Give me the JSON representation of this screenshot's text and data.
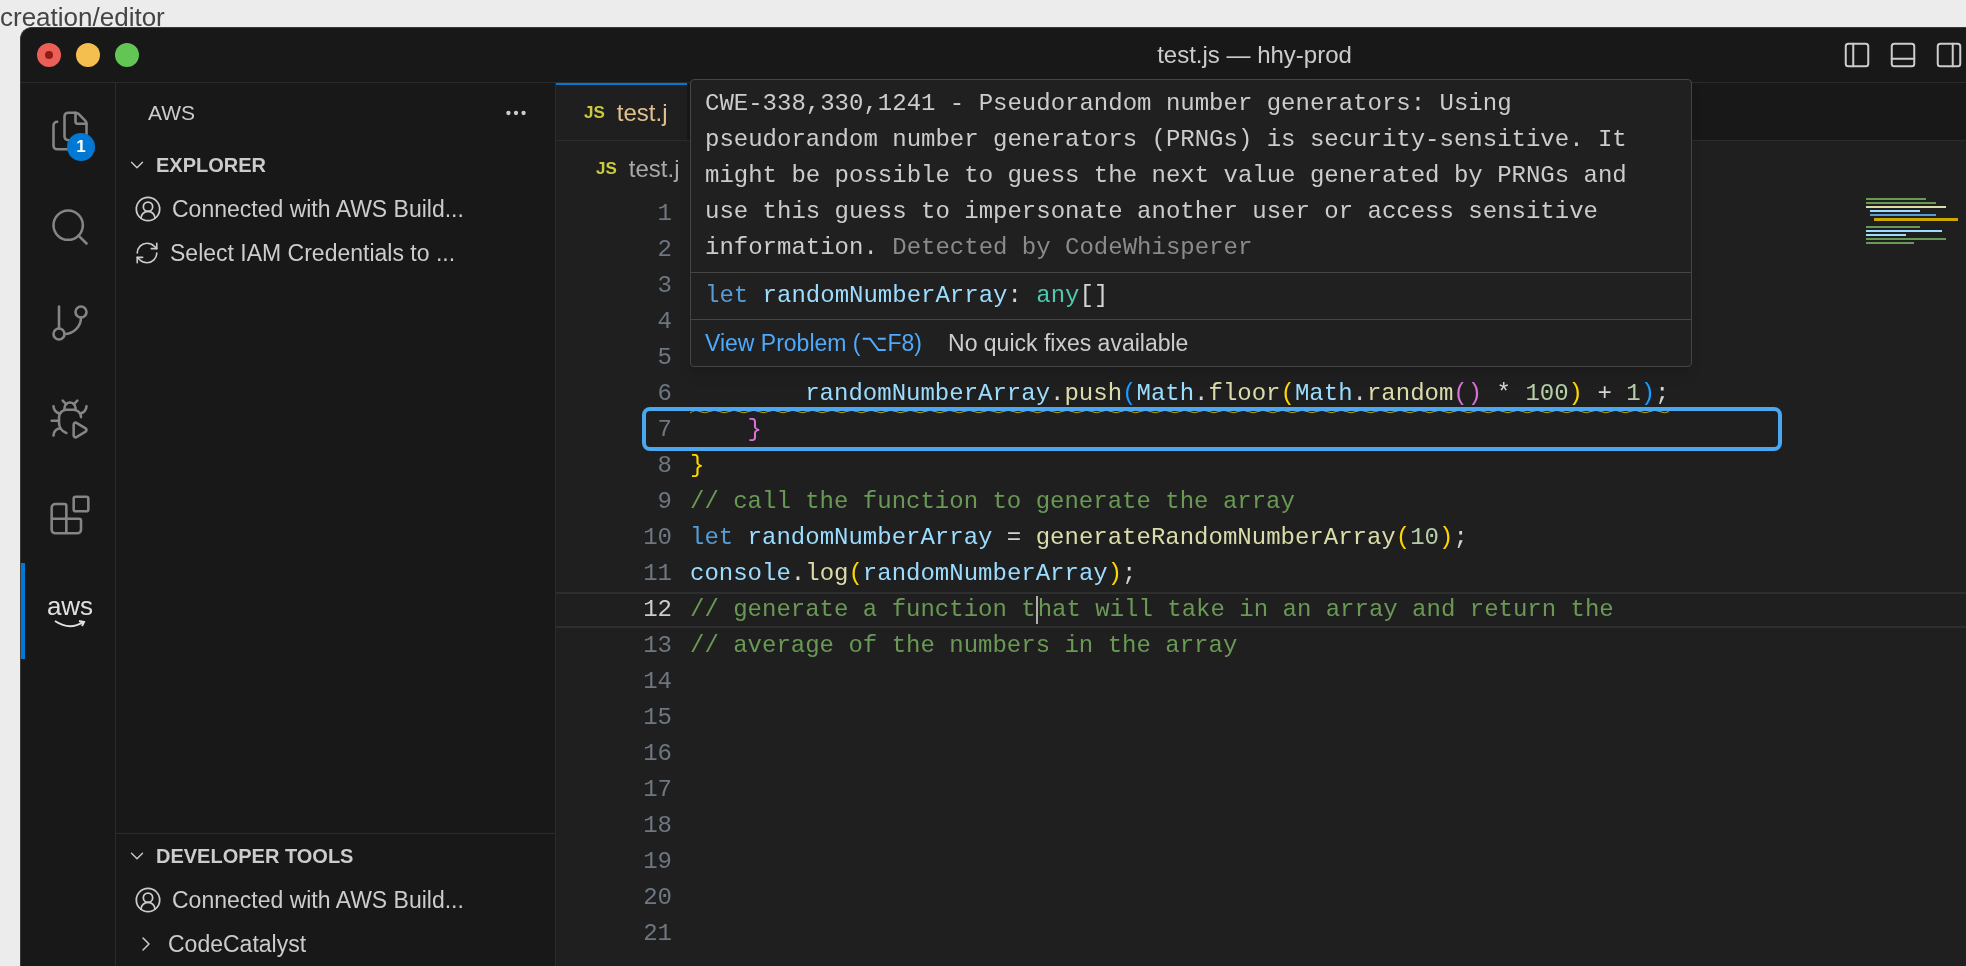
{
  "browser": {
    "url": "creation/editor"
  },
  "window": {
    "title": "test.js — hhy-prod"
  },
  "activity_bar": [
    {
      "kind": "files",
      "badge": "1",
      "selected": false
    },
    {
      "kind": "search",
      "selected": false
    },
    {
      "kind": "source-control",
      "selected": false
    },
    {
      "kind": "run-debug",
      "selected": false
    },
    {
      "kind": "extensions",
      "selected": false
    },
    {
      "kind": "aws",
      "label": "aws",
      "selected": true
    }
  ],
  "sidebar": {
    "title": "AWS",
    "sections": [
      {
        "title": "EXPLORER",
        "expanded": true,
        "items": [
          {
            "kind": "account",
            "label": "Connected with AWS Build..."
          },
          {
            "kind": "sync",
            "label": "Select IAM Credentials to ..."
          }
        ]
      },
      {
        "title": "DEVELOPER TOOLS",
        "expanded": true,
        "items": [
          {
            "kind": "account",
            "label": "Connected with AWS Build..."
          },
          {
            "kind": "node",
            "expanded": false,
            "label": "CodeCatalyst"
          }
        ]
      }
    ]
  },
  "tabs": [
    {
      "file_icon": "JS",
      "label": "test.j",
      "selected": true
    }
  ],
  "breadcrumb": {
    "file_icon": "JS",
    "label": "test.j"
  },
  "editor": {
    "lines": [
      {
        "number": "1"
      },
      {
        "number": "2"
      },
      {
        "number": "3"
      },
      {
        "number": "4"
      },
      {
        "number": "5"
      },
      {
        "number": "6",
        "problem": true,
        "tokens": [
          {
            "kind": "var",
            "text": "        randomNumberArray"
          },
          {
            "kind": "plain",
            "text": "."
          },
          {
            "kind": "func",
            "text": "push"
          },
          {
            "kind": "bracket3",
            "text": "("
          },
          {
            "kind": "var",
            "text": "Math"
          },
          {
            "kind": "plain",
            "text": "."
          },
          {
            "kind": "func",
            "text": "floor"
          },
          {
            "kind": "bracket1",
            "text": "("
          },
          {
            "kind": "var",
            "text": "Math"
          },
          {
            "kind": "plain",
            "text": "."
          },
          {
            "kind": "func",
            "text": "random"
          },
          {
            "kind": "bracket2",
            "text": "()"
          },
          {
            "kind": "plain",
            "text": " * "
          },
          {
            "kind": "number",
            "text": "100"
          },
          {
            "kind": "bracket1",
            "text": ")"
          },
          {
            "kind": "plain",
            "text": " + "
          },
          {
            "kind": "number",
            "text": "1"
          },
          {
            "kind": "bracket3",
            "text": ")"
          },
          {
            "kind": "plain",
            "text": ";"
          }
        ]
      },
      {
        "number": "7",
        "tokens": [
          {
            "kind": "bracket2",
            "text": "    }"
          }
        ]
      },
      {
        "number": "8",
        "tokens": [
          {
            "kind": "bracket1",
            "text": "}"
          }
        ]
      },
      {
        "number": "9",
        "tokens": [
          {
            "kind": "comment",
            "text": "// call the function to generate the array"
          }
        ]
      },
      {
        "number": "10",
        "tokens": [
          {
            "kind": "keyword",
            "text": "let"
          },
          {
            "kind": "var",
            "text": " randomNumberArray"
          },
          {
            "kind": "plain",
            "text": " = "
          },
          {
            "kind": "func",
            "text": "generateRandomNumberArray"
          },
          {
            "kind": "bracket1",
            "text": "("
          },
          {
            "kind": "number",
            "text": "10"
          },
          {
            "kind": "bracket1",
            "text": ")"
          },
          {
            "kind": "plain",
            "text": ";"
          }
        ]
      },
      {
        "number": "11",
        "tokens": [
          {
            "kind": "var",
            "text": "console"
          },
          {
            "kind": "plain",
            "text": "."
          },
          {
            "kind": "func",
            "text": "log"
          },
          {
            "kind": "bracket1",
            "text": "("
          },
          {
            "kind": "var",
            "text": "randomNumberArray"
          },
          {
            "kind": "bracket1",
            "text": ")"
          },
          {
            "kind": "plain",
            "text": ";"
          }
        ]
      },
      {
        "number": "12",
        "current": true,
        "tokens": [
          {
            "kind": "comment",
            "text": "// generate a function t"
          },
          {
            "kind": "cursor"
          },
          {
            "kind": "comment",
            "text": "hat will take in an array and return the"
          }
        ]
      },
      {
        "number": "13",
        "tokens": [
          {
            "kind": "comment",
            "text": "// average of the numbers in the array"
          }
        ]
      },
      {
        "number": "14"
      },
      {
        "number": "15"
      },
      {
        "number": "16"
      },
      {
        "number": "17"
      },
      {
        "number": "18"
      },
      {
        "number": "19"
      },
      {
        "number": "20"
      },
      {
        "number": "21"
      }
    ]
  },
  "hover": {
    "message": "CWE-338,330,1241 - Pseudorandom number generators: Using pseudorandom number generators (PRNGs) is security-sensitive. It might be possible to guess the next value generated by PRNGs and use this guess to impersonate another user or access sensitive information.",
    "source": "Detected by CodeWhisperer",
    "signature": [
      {
        "kind": "keyword",
        "text": "let"
      },
      {
        "kind": "var",
        "text": " randomNumberArray"
      },
      {
        "kind": "plain",
        "text": ": "
      },
      {
        "kind": "type",
        "text": "any"
      },
      {
        "kind": "plain",
        "text": "[]"
      }
    ],
    "actions": [
      {
        "kind": "link",
        "label": "View Problem (⌥F8)"
      },
      {
        "kind": "text",
        "label": "No quick fixes available"
      }
    ]
  }
}
